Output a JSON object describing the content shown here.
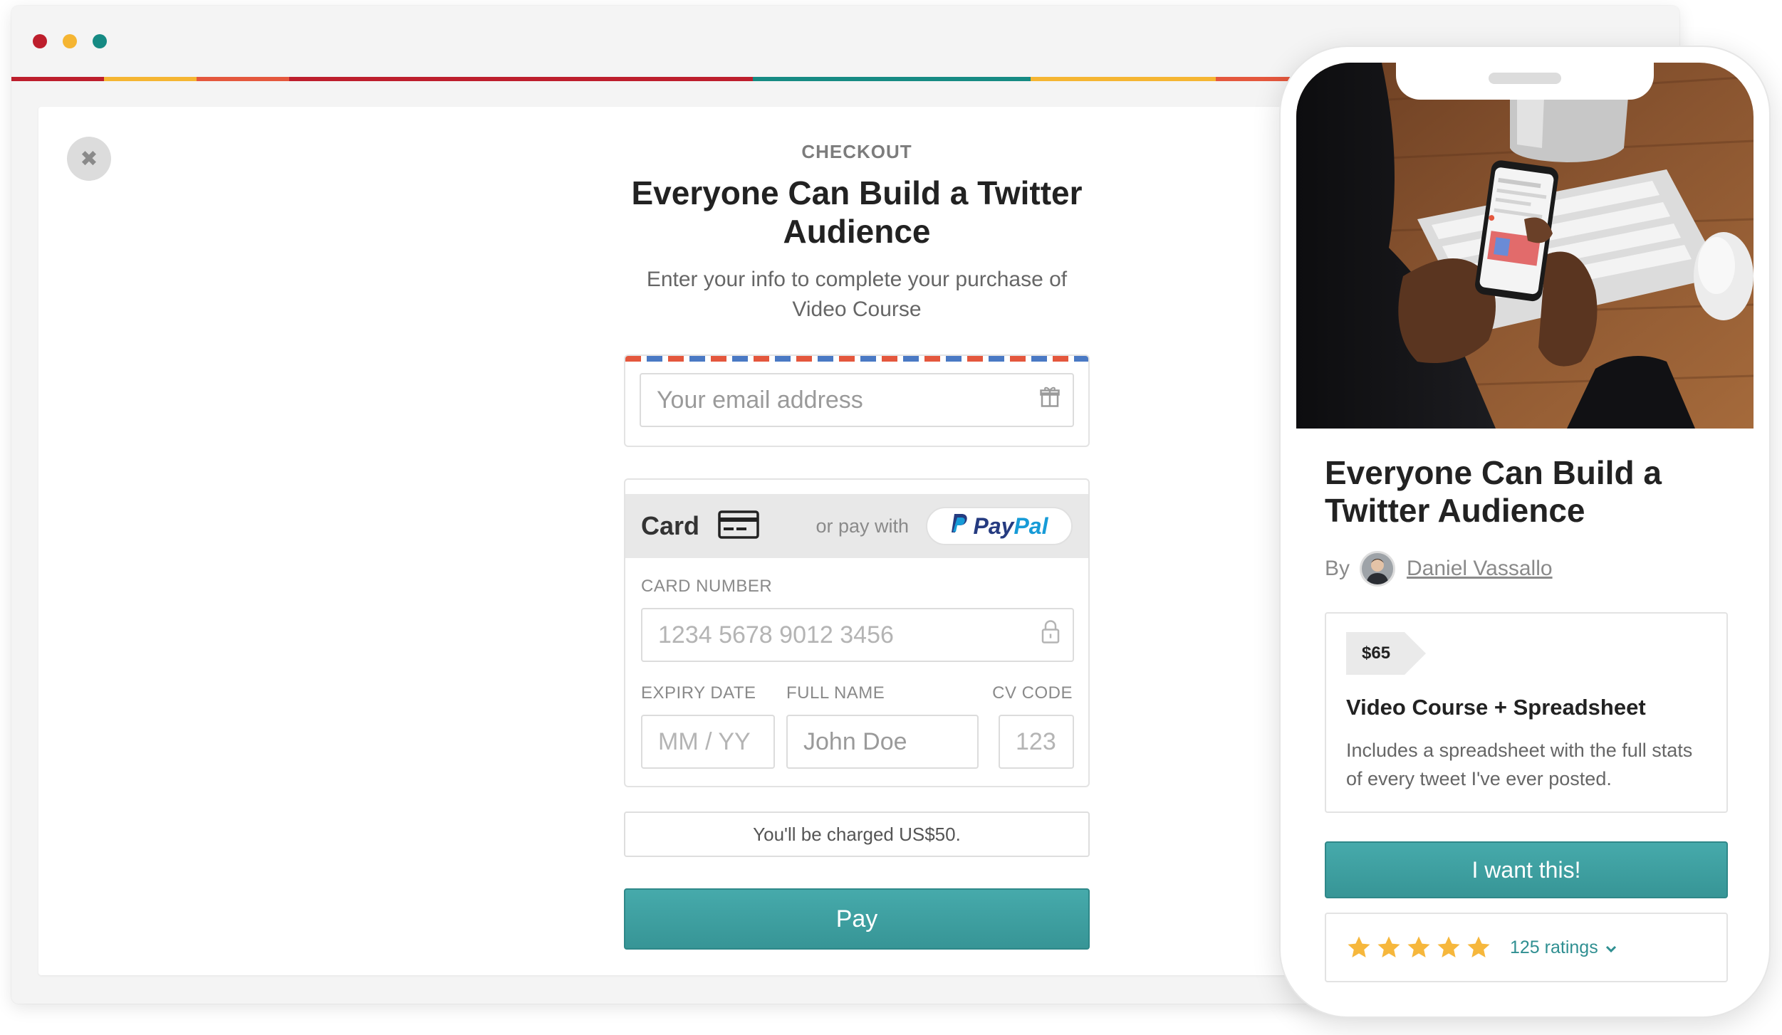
{
  "colors": {
    "window_dots": [
      "#bd1e2c",
      "#f5b532",
      "#168a83"
    ],
    "stripe": [
      "#bd1e2c",
      "#f5b532",
      "#e4573d",
      "#bd1e2c",
      "#bd1e2c",
      "#bd1e2c",
      "#bd1e2c",
      "#bd1e2c",
      "#168a83",
      "#168a83",
      "#168a83",
      "#f5b532",
      "#f5b532",
      "#e4573d",
      "#e4573d",
      "#bd1e2c",
      "#bd1e2c",
      "#bd1e2c"
    ],
    "accent": "#3ea0a1"
  },
  "checkout": {
    "eyebrow": "CHECKOUT",
    "title": "Everyone Can Build a Twitter Audience",
    "subtitle": "Enter your info to complete your purchase of Video Course",
    "email_placeholder": "Your email address",
    "payment": {
      "card_label": "Card",
      "or_pay_with": "or pay with",
      "paypal_part1": "Pay",
      "paypal_part2": "Pal",
      "card_number_label": "CARD NUMBER",
      "card_number_placeholder": "1234 5678 9012 3456",
      "expiry_label": "EXPIRY DATE",
      "expiry_placeholder": "MM / YY",
      "name_label": "FULL NAME",
      "name_placeholder": "John Doe",
      "cvc_label": "CV CODE",
      "cvc_placeholder": "123"
    },
    "charge_text": "You'll be charged US$50.",
    "pay_button": "Pay"
  },
  "product": {
    "title": "Everyone Can Build a Twitter Audience",
    "by": "By",
    "author": "Daniel Vassallo",
    "price": "$65",
    "offer_name": "Video Course + Spreadsheet",
    "offer_desc": "Includes a spreadsheet with the full stats of every tweet I've ever posted.",
    "cta": "I want this!",
    "rating_stars": 5,
    "ratings_count": "125 ratings"
  }
}
